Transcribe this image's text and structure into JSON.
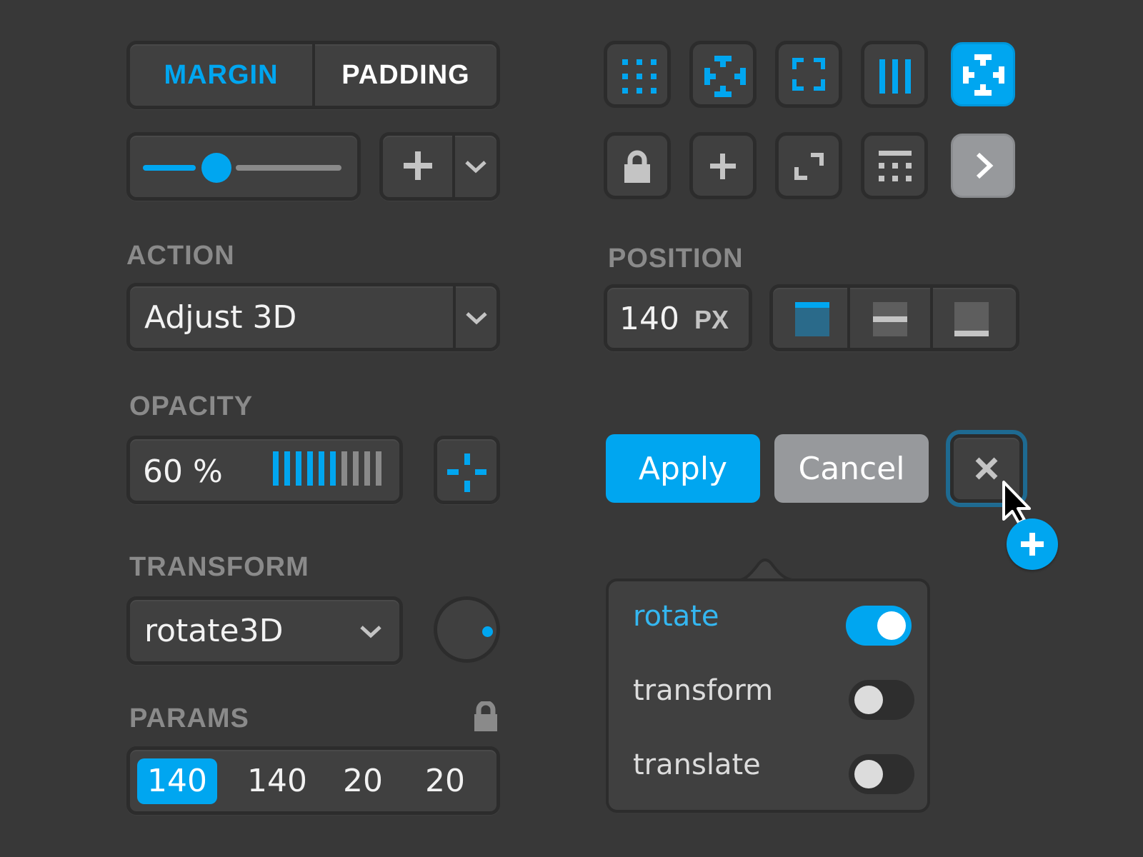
{
  "colors": {
    "background": "#383838",
    "control": "#404040",
    "border": "#2c2c2c",
    "accent": "#00a6f0",
    "label": "#8a8a8a",
    "muted_button": "#97999c",
    "icon_grey": "#c4c4c4"
  },
  "box_model_tabs": {
    "items": [
      {
        "label": "MARGIN",
        "active": true
      },
      {
        "label": "PADDING",
        "active": false
      }
    ]
  },
  "size_slider": {
    "value_fraction": 0.37
  },
  "add_split_button": {
    "icon": "plus-icon",
    "menu_icon": "chevron-down-icon"
  },
  "icon_toolbar": {
    "row1": [
      {
        "name": "grid-dots-icon",
        "active": false
      },
      {
        "name": "distribute-center-icon",
        "active": false
      },
      {
        "name": "fit-corners-icon",
        "active": false
      },
      {
        "name": "columns-icon",
        "active": false
      },
      {
        "name": "distribute-center-icon",
        "active": true
      }
    ],
    "row2": [
      {
        "name": "lock-icon"
      },
      {
        "name": "plus-icon"
      },
      {
        "name": "expand-icon"
      },
      {
        "name": "table-layout-icon"
      },
      {
        "name": "chevron-right-icon"
      }
    ]
  },
  "action": {
    "label": "ACTION",
    "selected": "Adjust 3D"
  },
  "position": {
    "label": "POSITION",
    "value": "140",
    "unit": "PX",
    "align_options": [
      {
        "name": "align-top",
        "active": true
      },
      {
        "name": "align-middle",
        "active": false
      },
      {
        "name": "align-bottom",
        "active": false
      }
    ]
  },
  "opacity": {
    "label": "OPACITY",
    "value_text": "60 %",
    "value_percent": 60,
    "bar_count": 10,
    "crosshair_icon": "crosshair-icon"
  },
  "buttons": {
    "apply": "Apply",
    "cancel": "Cancel",
    "close_icon": "close-icon"
  },
  "transform": {
    "label": "TRANSFORM",
    "selected": "rotate3D",
    "dial_angle_deg": 0
  },
  "params": {
    "label": "PARAMS",
    "lock_icon": "lock-icon",
    "values": [
      {
        "value": "140",
        "active": true
      },
      {
        "value": "140",
        "active": false
      },
      {
        "value": "20",
        "active": false
      },
      {
        "value": "20",
        "active": false
      }
    ]
  },
  "transform_popover": {
    "items": [
      {
        "label": "rotate",
        "enabled": true
      },
      {
        "label": "transform",
        "enabled": false
      },
      {
        "label": "translate",
        "enabled": false
      }
    ]
  },
  "cursor": {
    "badge_icon": "plus-icon"
  }
}
